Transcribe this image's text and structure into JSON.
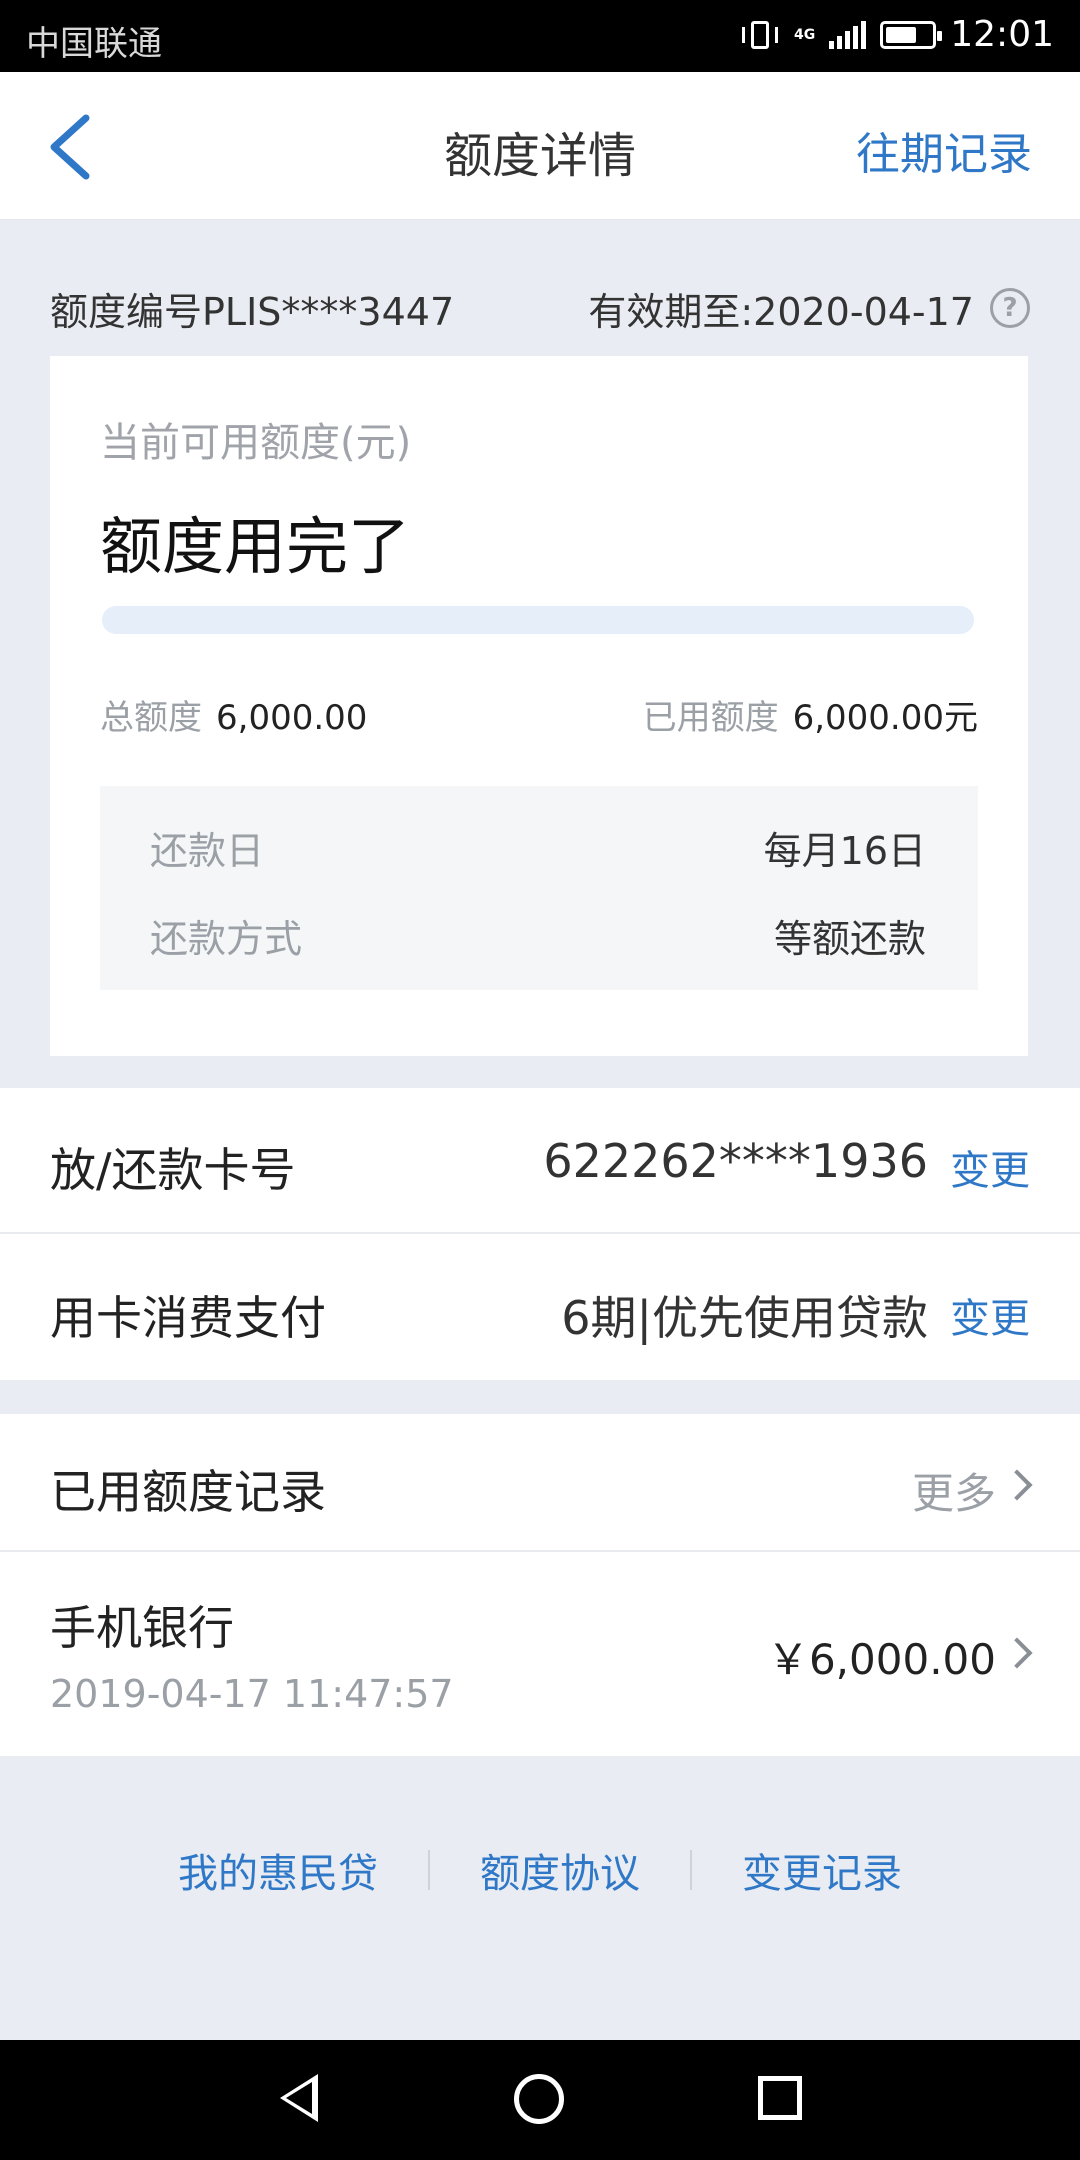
{
  "status_bar": {
    "carrier": "中国联通",
    "network": "4G",
    "time": "12:01"
  },
  "header": {
    "title": "额度详情",
    "history_link": "往期记录"
  },
  "quota": {
    "number_label": "额度编号PLIS****3447",
    "valid_until": "有效期至:2020-04-17",
    "available_label": "当前可用额度(元)",
    "available_status": "额度用完了",
    "used_fraction": 1.0,
    "total_label": "总额度",
    "total_value": "6,000.00",
    "used_label": "已用额度",
    "used_value": "6,000.00元",
    "repay_day_label": "还款日",
    "repay_day_value": "每月16日",
    "repay_method_label": "还款方式",
    "repay_method_value": "等额还款"
  },
  "card_row": {
    "label": "放/还款卡号",
    "value": "622262****1936",
    "action": "变更"
  },
  "pay_row": {
    "label": "用卡消费支付",
    "value": "6期|优先使用贷款",
    "action": "变更"
  },
  "records": {
    "title": "已用额度记录",
    "more": "更多",
    "items": [
      {
        "name": "手机银行",
        "time": "2019-04-17 11:47:57",
        "amount": "￥6,000.00"
      }
    ]
  },
  "footer": {
    "links": [
      "我的惠民贷",
      "额度协议",
      "变更记录"
    ]
  },
  "colors": {
    "accent": "#2f77c7",
    "background": "#e9edf3",
    "progress_track": "#e6eef9"
  },
  "icons": {
    "back": "chevron-left-icon",
    "help": "question-circle-icon",
    "more": "chevron-right-icon"
  }
}
